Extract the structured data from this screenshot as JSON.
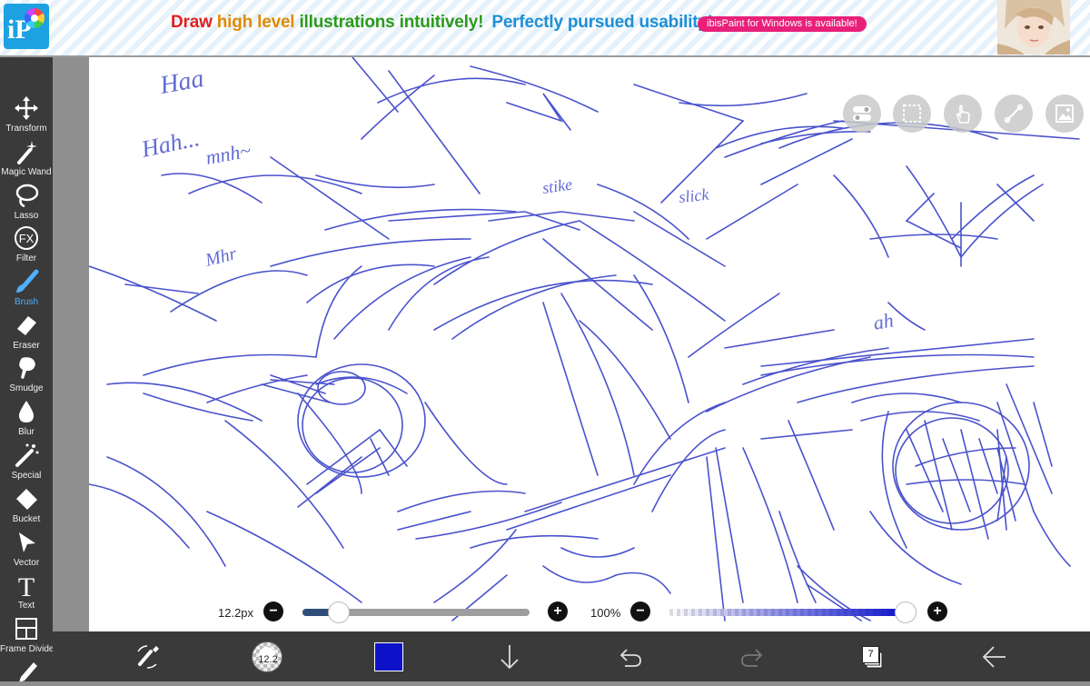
{
  "banner": {
    "headline_part1": "Draw ",
    "headline_part2": "high level ",
    "headline_part3": "illustrations intuitively!",
    "headline_part4": "Perfectly pursued usability!",
    "pill": "ibisPaint for Windows is available!",
    "colors": {
      "red": "#e02020",
      "orange": "#e08a00",
      "green": "#2a9a1a",
      "blue": "#1c8fd6",
      "pill": "#e8207a"
    }
  },
  "tools": [
    {
      "label": "Transform",
      "icon": "transform-icon"
    },
    {
      "label": "Magic Wand",
      "icon": "magic-wand-icon"
    },
    {
      "label": "Lasso",
      "icon": "lasso-icon"
    },
    {
      "label": "Filter",
      "icon": "fx-filter-icon"
    },
    {
      "label": "Brush",
      "icon": "brush-icon",
      "active": true
    },
    {
      "label": "Eraser",
      "icon": "eraser-icon"
    },
    {
      "label": "Smudge",
      "icon": "smudge-icon"
    },
    {
      "label": "Blur",
      "icon": "blur-drop-icon"
    },
    {
      "label": "Special",
      "icon": "special-wand-icon"
    },
    {
      "label": "Bucket",
      "icon": "bucket-icon"
    },
    {
      "label": "Vector",
      "icon": "vector-arrow-icon"
    },
    {
      "label": "Text",
      "icon": "text-icon"
    },
    {
      "label": "Frame Divider",
      "icon": "frame-divider-icon"
    }
  ],
  "canvas": {
    "sketch_text": [
      "Hah...",
      "mnh~",
      "stike",
      "slick",
      "Mhr",
      "ah",
      "Haa"
    ],
    "stroke_color": "#2b34c4"
  },
  "sliders": {
    "size_label": "12.2px",
    "size_value_fraction": 0.16,
    "opacity_label": "100%",
    "opacity_value_fraction": 1.0
  },
  "bottom": {
    "brush_size": "12.2",
    "current_color": "#0d12c9",
    "layer_count": "7"
  }
}
